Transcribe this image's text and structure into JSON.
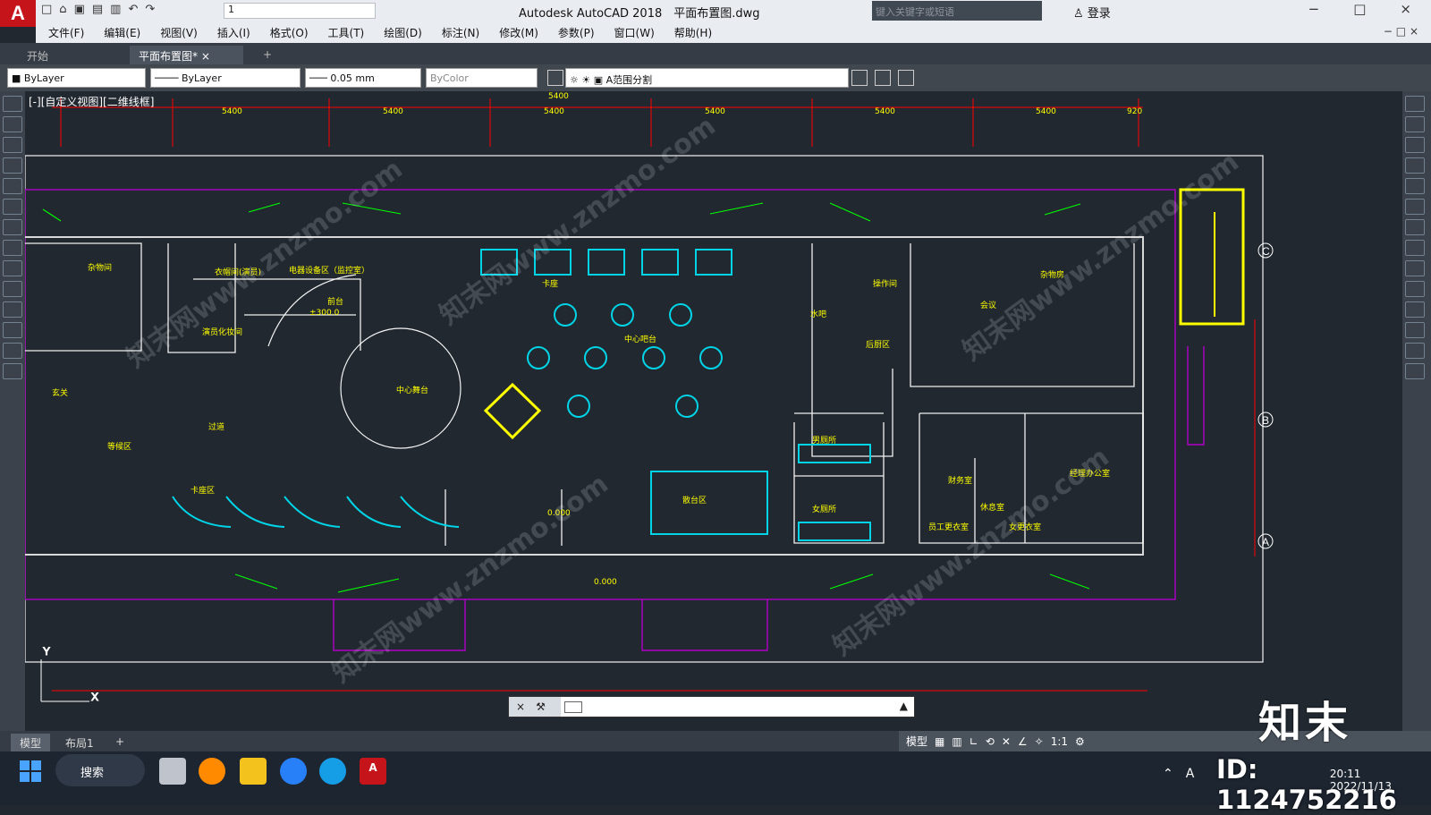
{
  "titlebar": {
    "app_title": "Autodesk AutoCAD 2018",
    "file_name": "平面布置图.dwg",
    "workspace_value": "1",
    "search_placeholder": "键入关键字或短语",
    "login_label": "登录",
    "window_controls": [
      "minimize-icon",
      "restore-icon",
      "close-icon"
    ]
  },
  "menubar": {
    "items": [
      "文件(F)",
      "编辑(E)",
      "视图(V)",
      "插入(I)",
      "格式(O)",
      "工具(T)",
      "绘图(D)",
      "标注(N)",
      "修改(M)",
      "参数(P)",
      "窗口(W)",
      "帮助(H)"
    ],
    "doc_controls": "− □ ×"
  },
  "tabs": {
    "start": "开始",
    "active": "平面布置图*",
    "add": "+"
  },
  "properties": {
    "color": "ByLayer",
    "linetype": "ByLayer",
    "lineweight": "0.05 mm",
    "plot_style": "ByColor",
    "layer": "A范围分割"
  },
  "viewport": {
    "view_label": "[-][自定义视图][二维线框]",
    "axis_y": "Y",
    "axis_x": "X",
    "grid_labels": [
      "C",
      "B",
      "A"
    ],
    "watermark_text": "知末网www.znzmo.com"
  },
  "drawing": {
    "room_labels": [
      "杂物间",
      "衣帽间(演员)",
      "电器设备区（监控室）",
      "前台",
      "演员化妆间",
      "卡座",
      "中心吧台",
      "中心舞台",
      "玄关",
      "过道",
      "等候区",
      "卡座区",
      "散台区",
      "男厕所",
      "女厕所",
      "操作间",
      "水吧",
      "后厨区",
      "杂物房",
      "会议",
      "经理办公室",
      "财务室",
      "休息室",
      "员工更衣室",
      "女更衣室"
    ],
    "elevations": [
      "±300.0",
      "0.000",
      "0.000"
    ],
    "dimension_labels": [
      "5400",
      "5400",
      "5400",
      "5400",
      "5400",
      "5400",
      "5400",
      "920"
    ]
  },
  "status": {
    "model_tab": "模型",
    "layout_tab": "布局1",
    "model_button": "模型",
    "scale": "1:1"
  },
  "taskbar": {
    "search_label": "搜索",
    "time": "20:11",
    "date": "2022/11/13"
  },
  "overlay": {
    "brand": "知末",
    "id_text": "ID: 1124752216"
  },
  "colors": {
    "canvas": "#212830",
    "cyan": "#00d4e6",
    "yellow": "#ffff00",
    "magenta": "#b000c8",
    "red": "#ff0000",
    "green": "#00ff00",
    "white": "#f4f4f4"
  }
}
